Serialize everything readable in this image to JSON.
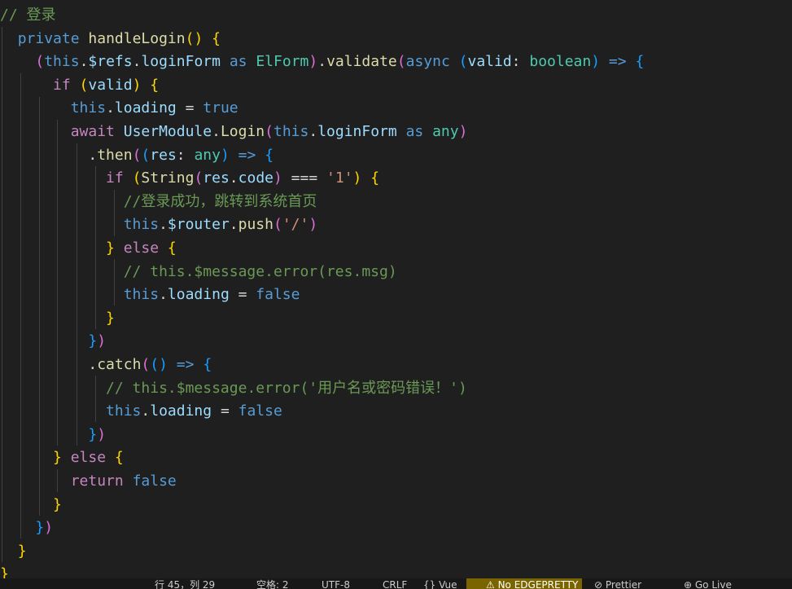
{
  "editor": {
    "lines": [
      [
        {
          "t": "// 登录",
          "c": "comment"
        }
      ],
      [
        {
          "t": "  "
        },
        {
          "t": "private ",
          "c": "kw"
        },
        {
          "t": "handleLogin",
          "c": "fn"
        },
        {
          "t": "(",
          "c": "b1"
        },
        {
          "t": ")",
          "c": "b1"
        },
        {
          "t": " "
        },
        {
          "t": "{",
          "c": "b1"
        }
      ],
      [
        {
          "t": "    "
        },
        {
          "t": "(",
          "c": "b2"
        },
        {
          "t": "this",
          "c": "kw"
        },
        {
          "t": "."
        },
        {
          "t": "$refs",
          "c": "var"
        },
        {
          "t": "."
        },
        {
          "t": "loginForm",
          "c": "var"
        },
        {
          "t": " "
        },
        {
          "t": "as ",
          "c": "kw"
        },
        {
          "t": "ElForm",
          "c": "type"
        },
        {
          "t": ")",
          "c": "b2"
        },
        {
          "t": "."
        },
        {
          "t": "validate",
          "c": "fn"
        },
        {
          "t": "(",
          "c": "b2"
        },
        {
          "t": "async ",
          "c": "kw"
        },
        {
          "t": "(",
          "c": "b3"
        },
        {
          "t": "valid",
          "c": "var"
        },
        {
          "t": ": "
        },
        {
          "t": "boolean",
          "c": "type"
        },
        {
          "t": ")",
          "c": "b3"
        },
        {
          "t": " "
        },
        {
          "t": "=>",
          "c": "kw"
        },
        {
          "t": " "
        },
        {
          "t": "{",
          "c": "b3"
        }
      ],
      [
        {
          "t": "      "
        },
        {
          "t": "if ",
          "c": "ctrl"
        },
        {
          "t": "(",
          "c": "b1"
        },
        {
          "t": "valid",
          "c": "var"
        },
        {
          "t": ")",
          "c": "b1"
        },
        {
          "t": " "
        },
        {
          "t": "{",
          "c": "b1"
        }
      ],
      [
        {
          "t": "        "
        },
        {
          "t": "this",
          "c": "kw"
        },
        {
          "t": "."
        },
        {
          "t": "loading",
          "c": "var"
        },
        {
          "t": " = "
        },
        {
          "t": "true",
          "c": "kw"
        }
      ],
      [
        {
          "t": "        "
        },
        {
          "t": "await ",
          "c": "ctrl"
        },
        {
          "t": "UserModule",
          "c": "var"
        },
        {
          "t": "."
        },
        {
          "t": "Login",
          "c": "fn"
        },
        {
          "t": "(",
          "c": "b2"
        },
        {
          "t": "this",
          "c": "kw"
        },
        {
          "t": "."
        },
        {
          "t": "loginForm",
          "c": "var"
        },
        {
          "t": " "
        },
        {
          "t": "as ",
          "c": "kw"
        },
        {
          "t": "any",
          "c": "type"
        },
        {
          "t": ")",
          "c": "b2"
        }
      ],
      [
        {
          "t": "          "
        },
        {
          "t": "."
        },
        {
          "t": "then",
          "c": "fn"
        },
        {
          "t": "(",
          "c": "b2"
        },
        {
          "t": "(",
          "c": "b3"
        },
        {
          "t": "res",
          "c": "var"
        },
        {
          "t": ": "
        },
        {
          "t": "any",
          "c": "type"
        },
        {
          "t": ")",
          "c": "b3"
        },
        {
          "t": " "
        },
        {
          "t": "=>",
          "c": "kw"
        },
        {
          "t": " "
        },
        {
          "t": "{",
          "c": "b3"
        }
      ],
      [
        {
          "t": "            "
        },
        {
          "t": "if ",
          "c": "ctrl"
        },
        {
          "t": "(",
          "c": "b1"
        },
        {
          "t": "String",
          "c": "fn"
        },
        {
          "t": "(",
          "c": "b2"
        },
        {
          "t": "res",
          "c": "var"
        },
        {
          "t": "."
        },
        {
          "t": "code",
          "c": "var"
        },
        {
          "t": ")",
          "c": "b2"
        },
        {
          "t": " === "
        },
        {
          "t": "'1'",
          "c": "str"
        },
        {
          "t": ")",
          "c": "b1"
        },
        {
          "t": " "
        },
        {
          "t": "{",
          "c": "b1"
        }
      ],
      [
        {
          "t": "              "
        },
        {
          "t": "//登录成功，跳转到系统首页",
          "c": "comment"
        }
      ],
      [
        {
          "t": "              "
        },
        {
          "t": "this",
          "c": "kw"
        },
        {
          "t": "."
        },
        {
          "t": "$router",
          "c": "var"
        },
        {
          "t": "."
        },
        {
          "t": "push",
          "c": "fn"
        },
        {
          "t": "(",
          "c": "b2"
        },
        {
          "t": "'/'",
          "c": "str"
        },
        {
          "t": ")",
          "c": "b2"
        }
      ],
      [
        {
          "t": "            "
        },
        {
          "t": "}",
          "c": "b1"
        },
        {
          "t": " "
        },
        {
          "t": "else ",
          "c": "ctrl"
        },
        {
          "t": "{",
          "c": "b1"
        }
      ],
      [
        {
          "t": "              "
        },
        {
          "t": "// this.$message.error(res.msg)",
          "c": "comment"
        }
      ],
      [
        {
          "t": "              "
        },
        {
          "t": "this",
          "c": "kw"
        },
        {
          "t": "."
        },
        {
          "t": "loading",
          "c": "var"
        },
        {
          "t": " = "
        },
        {
          "t": "false",
          "c": "kw"
        }
      ],
      [
        {
          "t": "            "
        },
        {
          "t": "}",
          "c": "b1"
        }
      ],
      [
        {
          "t": "          "
        },
        {
          "t": "}",
          "c": "b3"
        },
        {
          "t": ")",
          "c": "b2"
        }
      ],
      [
        {
          "t": "          "
        },
        {
          "t": "."
        },
        {
          "t": "catch",
          "c": "fn"
        },
        {
          "t": "(",
          "c": "b2"
        },
        {
          "t": "(",
          "c": "b3"
        },
        {
          "t": ")",
          "c": "b3"
        },
        {
          "t": " "
        },
        {
          "t": "=>",
          "c": "kw"
        },
        {
          "t": " "
        },
        {
          "t": "{",
          "c": "b3"
        }
      ],
      [
        {
          "t": "            "
        },
        {
          "t": "// this.$message.error('用户名或密码错误！')",
          "c": "comment"
        }
      ],
      [
        {
          "t": "            "
        },
        {
          "t": "this",
          "c": "kw"
        },
        {
          "t": "."
        },
        {
          "t": "loading",
          "c": "var"
        },
        {
          "t": " = "
        },
        {
          "t": "false",
          "c": "kw"
        }
      ],
      [
        {
          "t": "          "
        },
        {
          "t": "}",
          "c": "b3"
        },
        {
          "t": ")",
          "c": "b2"
        }
      ],
      [
        {
          "t": "      "
        },
        {
          "t": "}",
          "c": "b1"
        },
        {
          "t": " "
        },
        {
          "t": "else ",
          "c": "ctrl"
        },
        {
          "t": "{",
          "c": "b1"
        }
      ],
      [
        {
          "t": "        "
        },
        {
          "t": "return ",
          "c": "ctrl"
        },
        {
          "t": "false",
          "c": "kw"
        }
      ],
      [
        {
          "t": "      "
        },
        {
          "t": "}",
          "c": "b1"
        }
      ],
      [
        {
          "t": "    "
        },
        {
          "t": "}",
          "c": "b3"
        },
        {
          "t": ")",
          "c": "b2"
        }
      ],
      [
        {
          "t": "  "
        },
        {
          "t": "}",
          "c": "b1"
        }
      ],
      [
        {
          "t": "}",
          "c": "b1"
        }
      ]
    ]
  },
  "statusbar": {
    "line_col": "行 45，列 29",
    "spaces": "空格: 2",
    "encoding": "UTF-8",
    "eol": "CRLF",
    "language": "{} Vue",
    "warning_label": "⚠ No EDGEPRETTY",
    "prettier": "⊘ Prettier",
    "go_live": "⊕ Go Live"
  },
  "colors": {
    "background": "#1f1f1f",
    "comment": "#6a9955",
    "keyword": "#569cd6",
    "control": "#c586c0",
    "function": "#dcdcaa",
    "variable": "#9cdcfe",
    "type": "#4ec9b0",
    "string": "#ce9178",
    "bracket1": "#ffd700",
    "bracket2": "#da70d6",
    "bracket3": "#179fff",
    "warning_bg": "#7a6400"
  }
}
